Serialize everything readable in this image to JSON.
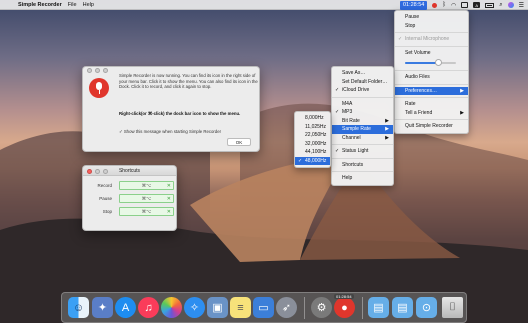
{
  "menubar": {
    "app_name": "Simple Recorder",
    "items": [
      "File",
      "Help"
    ],
    "record_time": "01:28:54"
  },
  "status_menu": {
    "items": [
      {
        "label": "Pause",
        "state": "normal"
      },
      {
        "label": "Stop",
        "state": "normal"
      },
      {
        "label": "Internal Microphone",
        "state": "disabled",
        "checked": true
      },
      {
        "label": "Set Volume",
        "state": "normal"
      },
      {
        "label": "Audio Files",
        "state": "normal"
      },
      {
        "label": "Preferences…",
        "state": "highlighted",
        "submenu": true
      },
      {
        "label": "Rate",
        "state": "normal"
      },
      {
        "label": "Tell a Friend",
        "state": "normal",
        "submenu": true
      },
      {
        "label": "Quit Simple Recorder",
        "state": "normal"
      }
    ],
    "volume_level": 0.65
  },
  "preferences_menu": {
    "items": [
      {
        "label": "Save As…"
      },
      {
        "label": "Set Default Folder…"
      },
      {
        "label": "iCloud Drive",
        "checked": true
      },
      {
        "label": "M4A"
      },
      {
        "label": "MP3",
        "checked": true
      },
      {
        "label": "Bit Rate",
        "submenu": true
      },
      {
        "label": "Sample Rate",
        "submenu": true,
        "highlighted": true
      },
      {
        "label": "Channel",
        "submenu": true
      },
      {
        "label": "Status Light",
        "checked": true
      },
      {
        "label": "Shortcuts"
      },
      {
        "label": "Help"
      }
    ]
  },
  "sample_rate_menu": {
    "items": [
      {
        "label": "8,000Hz"
      },
      {
        "label": "11,025Hz"
      },
      {
        "label": "22,050Hz"
      },
      {
        "label": "32,000Hz"
      },
      {
        "label": "44,100Hz"
      },
      {
        "label": "48,000Hz",
        "checked": true,
        "highlighted": true
      }
    ]
  },
  "dialog": {
    "text": "Simple Recorder is now running. You can find its icon in the right side of your menu bar. Click it to show the menu. You can also find its icon in the Dock. Click it to record, and click it again to stop.",
    "text2": "Right-click(or ⌘-click) the dock bar icon to show the menu.",
    "checkbox_label": "Show this message when starting Simple Recorder",
    "ok_label": "OK"
  },
  "shortcuts": {
    "title": "Shortcuts",
    "rows": [
      {
        "label": "Record",
        "value": "⌘⌥"
      },
      {
        "label": "Pause",
        "value": "⌘⌥"
      },
      {
        "label": "Stop",
        "value": "⌘⌥"
      }
    ]
  },
  "dock": {
    "recorder_badge": "01:28:54",
    "icons": [
      "finder-icon",
      "launchpad-icon",
      "app-store-icon",
      "music-icon",
      "photos-icon",
      "safari-icon",
      "preview-icon",
      "notes-icon",
      "keynote-icon",
      "rocket-icon",
      "system-preferences-icon",
      "simple-recorder-icon",
      "folder-icon",
      "folder-icon",
      "folder-icon",
      "trash-icon"
    ]
  },
  "colors": {
    "accent": "#2c6ddb",
    "record_red": "#e0362c",
    "shortcut_green": "#8bd08b"
  }
}
